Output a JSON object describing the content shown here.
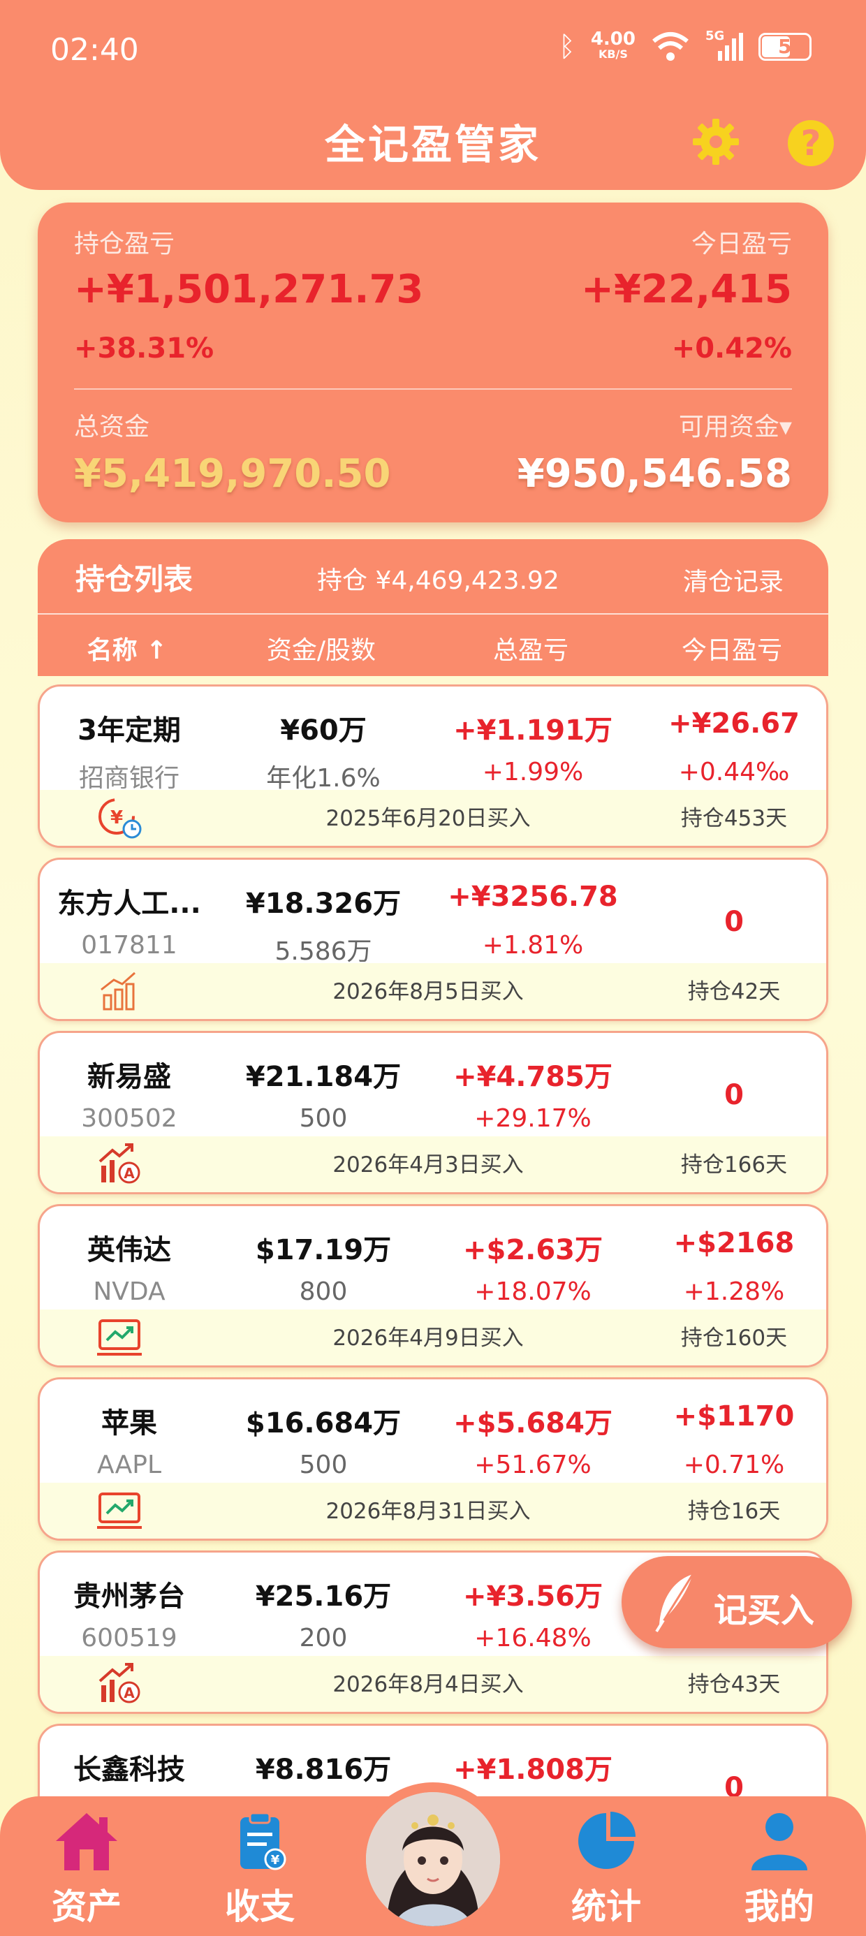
{
  "status": {
    "time": "02:40",
    "speed": "4.00",
    "speed_unit": "KB/S",
    "network": "5G",
    "battery": "58"
  },
  "app": {
    "title": "全记盈管家"
  },
  "summary": {
    "holding_pnl_label": "持仓盈亏",
    "holding_pnl": "+¥1,501,271.73",
    "holding_pnl_pct": "+38.31%",
    "today_pnl_label": "今日盈亏",
    "today_pnl": "+¥22,415",
    "today_pnl_pct": "+0.42%",
    "total_assets_label": "总资金",
    "total_assets": "¥5,419,970.50",
    "available_label": "可用资金▾",
    "available": "¥950,546.58"
  },
  "list": {
    "title": "持仓列表",
    "position_total": "持仓 ¥4,469,423.92",
    "clear_record": "清仓记录",
    "columns": [
      "名称 ↑",
      "资金/股数",
      "总盈亏",
      "今日盈亏"
    ]
  },
  "holdings": [
    {
      "name": "3年定期",
      "code": "招商银行",
      "amount": "¥60万",
      "qty": "年化1.6%",
      "pnl": "+¥1.191万",
      "pnl_pct": "+1.99%",
      "today": "+¥26.67",
      "today_pct": "+0.44‰",
      "date": "2025年6月20日买入",
      "held": "持仓453天",
      "icon": "deposit-clock-icon"
    },
    {
      "name": "东方人工...",
      "code": "017811",
      "amount": "¥18.326万",
      "qty": "5.586万",
      "pnl": "+¥3256.78",
      "pnl_pct": "+1.81%",
      "today": "0",
      "date": "2026年8月5日买入",
      "held": "持仓42天",
      "icon": "fund-bars-icon"
    },
    {
      "name": "新易盛",
      "code": "300502",
      "amount": "¥21.184万",
      "qty": "500",
      "pnl": "+¥4.785万",
      "pnl_pct": "+29.17%",
      "today": "0",
      "date": "2026年4月3日买入",
      "held": "持仓166天",
      "icon": "a-share-icon"
    },
    {
      "name": "英伟达",
      "code": "NVDA",
      "amount": "$17.19万",
      "qty": "800",
      "pnl": "+$2.63万",
      "pnl_pct": "+18.07%",
      "today": "+$2168",
      "today_pct": "+1.28%",
      "date": "2026年4月9日买入",
      "held": "持仓160天",
      "icon": "us-stock-icon"
    },
    {
      "name": "苹果",
      "code": "AAPL",
      "amount": "$16.684万",
      "qty": "500",
      "pnl": "+$5.684万",
      "pnl_pct": "+51.67%",
      "today": "+$1170",
      "today_pct": "+0.71%",
      "date": "2026年8月31日买入",
      "held": "持仓16天",
      "icon": "us-stock-icon"
    },
    {
      "name": "贵州茅台",
      "code": "600519",
      "amount": "¥25.16万",
      "qty": "200",
      "pnl": "+¥3.56万",
      "pnl_pct": "+16.48%",
      "date": "2026年8月4日买入",
      "held": "持仓43天",
      "icon": "a-share-icon"
    },
    {
      "name": "长鑫科技",
      "amount": "¥8.816万",
      "pnl": "+¥1.808万",
      "today": "0"
    }
  ],
  "fab": {
    "label": "记买入"
  },
  "nav": {
    "assets": "资产",
    "ledger": "收支",
    "stats": "统计",
    "mine": "我的"
  },
  "colors": {
    "primary": "#fa8b6c",
    "gain": "#e8232c",
    "gold": "#f8d576",
    "card_footer": "#fdfde0"
  }
}
